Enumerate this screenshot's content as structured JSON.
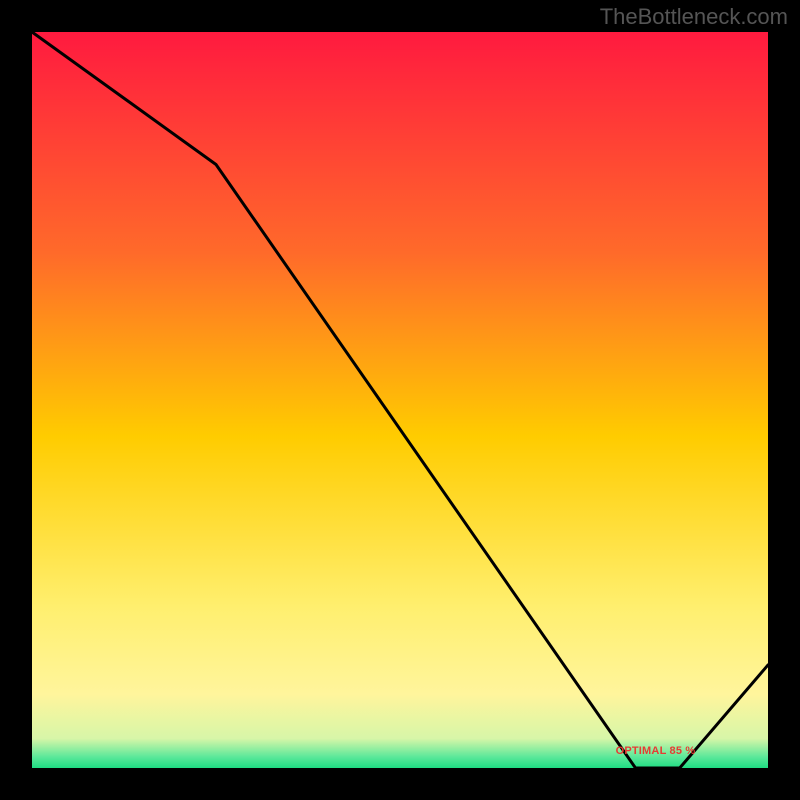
{
  "attribution": "TheBottleneck.com",
  "label_optimal": "OPTIMAL 85 %",
  "colors": {
    "top": "#ff1a3f",
    "mid": "#ffcc00",
    "lower": "#fff59c",
    "green": "#1fdc82"
  },
  "chart_data": {
    "type": "line",
    "title": "",
    "xlabel": "",
    "ylabel": "",
    "x": [
      0,
      25,
      82,
      88,
      100
    ],
    "values": [
      100,
      82,
      0,
      0,
      14
    ],
    "optimal_range_x": [
      82,
      88
    ],
    "optimal_y": 0,
    "ylim": [
      0,
      100
    ],
    "xlim": [
      0,
      100
    ],
    "annotations": [
      {
        "text": "OPTIMAL 85 %",
        "x": 85,
        "y": 1
      }
    ]
  }
}
